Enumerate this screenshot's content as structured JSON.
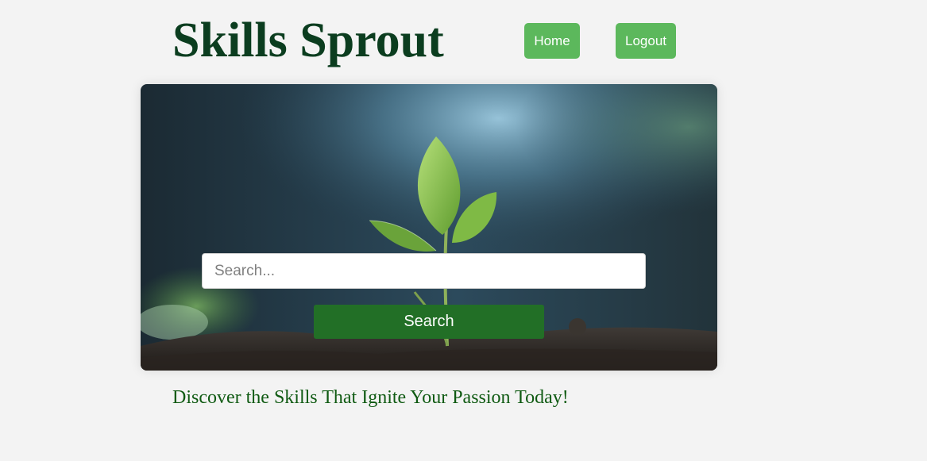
{
  "header": {
    "title": "Skills Sprout",
    "nav": {
      "home_label": "Home",
      "logout_label": "Logout"
    }
  },
  "hero": {
    "search": {
      "placeholder": "Search...",
      "value": "",
      "button_label": "Search"
    }
  },
  "tagline": "Discover the Skills That Ignite Your Passion Today!",
  "colors": {
    "page_background": "#f3f3f3",
    "title": "#0b3d1f",
    "nav_button": "#5cb85c",
    "search_button": "#226f26",
    "tagline": "#0f5a12"
  }
}
